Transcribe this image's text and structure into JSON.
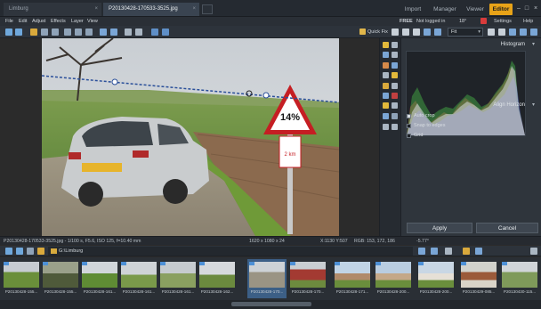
{
  "tabs": [
    {
      "label": "Limburg"
    },
    {
      "label": "P20130428-170533-3525.jpg"
    }
  ],
  "modes": [
    "Import",
    "Manager",
    "Viewer",
    "Editor"
  ],
  "active_mode": "Editor",
  "menu": [
    "File",
    "Edit",
    "Adjust",
    "Effects",
    "Layer",
    "View"
  ],
  "account": {
    "free": "FREE",
    "status": "Not logged in",
    "temp": "18°",
    "settings": "Settings",
    "help": "Help"
  },
  "toolbar": {
    "quick_fix": "Quick Fix",
    "zoom_mode": "Fit"
  },
  "panel": {
    "histogram_title": "Histogram",
    "align_title": "Align Horizon",
    "options": [
      {
        "label": "Auto crop",
        "checked": true
      },
      {
        "label": "Snap to edges",
        "checked": false
      },
      {
        "label": "Grid",
        "checked": false
      }
    ],
    "apply": "Apply",
    "cancel": "Cancel"
  },
  "image": {
    "sign_text": "14%",
    "sign_plate": "2 km"
  },
  "status": {
    "file_info": "P20130428-170533-3525.jpg - 1/100 s, F5.6, ISO 125, f=10.40 mm",
    "dimensions": "1620 x 1080 x 24",
    "coords": "X:1130 Y:507",
    "rgb": "RGB: 153, 172, 186",
    "angle": "-5.77°"
  },
  "folder_path": "G:\\Limburg",
  "thumbnails": [
    {
      "label": "P20130428-155..."
    },
    {
      "label": "P20130428-155..."
    },
    {
      "label": "P20130428-161..."
    },
    {
      "label": "P20130428-161..."
    },
    {
      "label": "P20130428-161..."
    },
    {
      "label": "P20130428-162..."
    },
    {
      "label": "P20130428-170..."
    },
    {
      "label": "P20130428-170..."
    },
    {
      "label": "P20130428-171..."
    },
    {
      "label": "P20130428-200..."
    },
    {
      "label": "P20130428-200..."
    },
    {
      "label": "P20130429-085..."
    },
    {
      "label": "P20130430-115..."
    },
    {
      "label": "P20130430-161..."
    }
  ],
  "selected_thumbnail": 6,
  "colors": {
    "accent": "#e8a318",
    "selection": "#3c5f86"
  }
}
